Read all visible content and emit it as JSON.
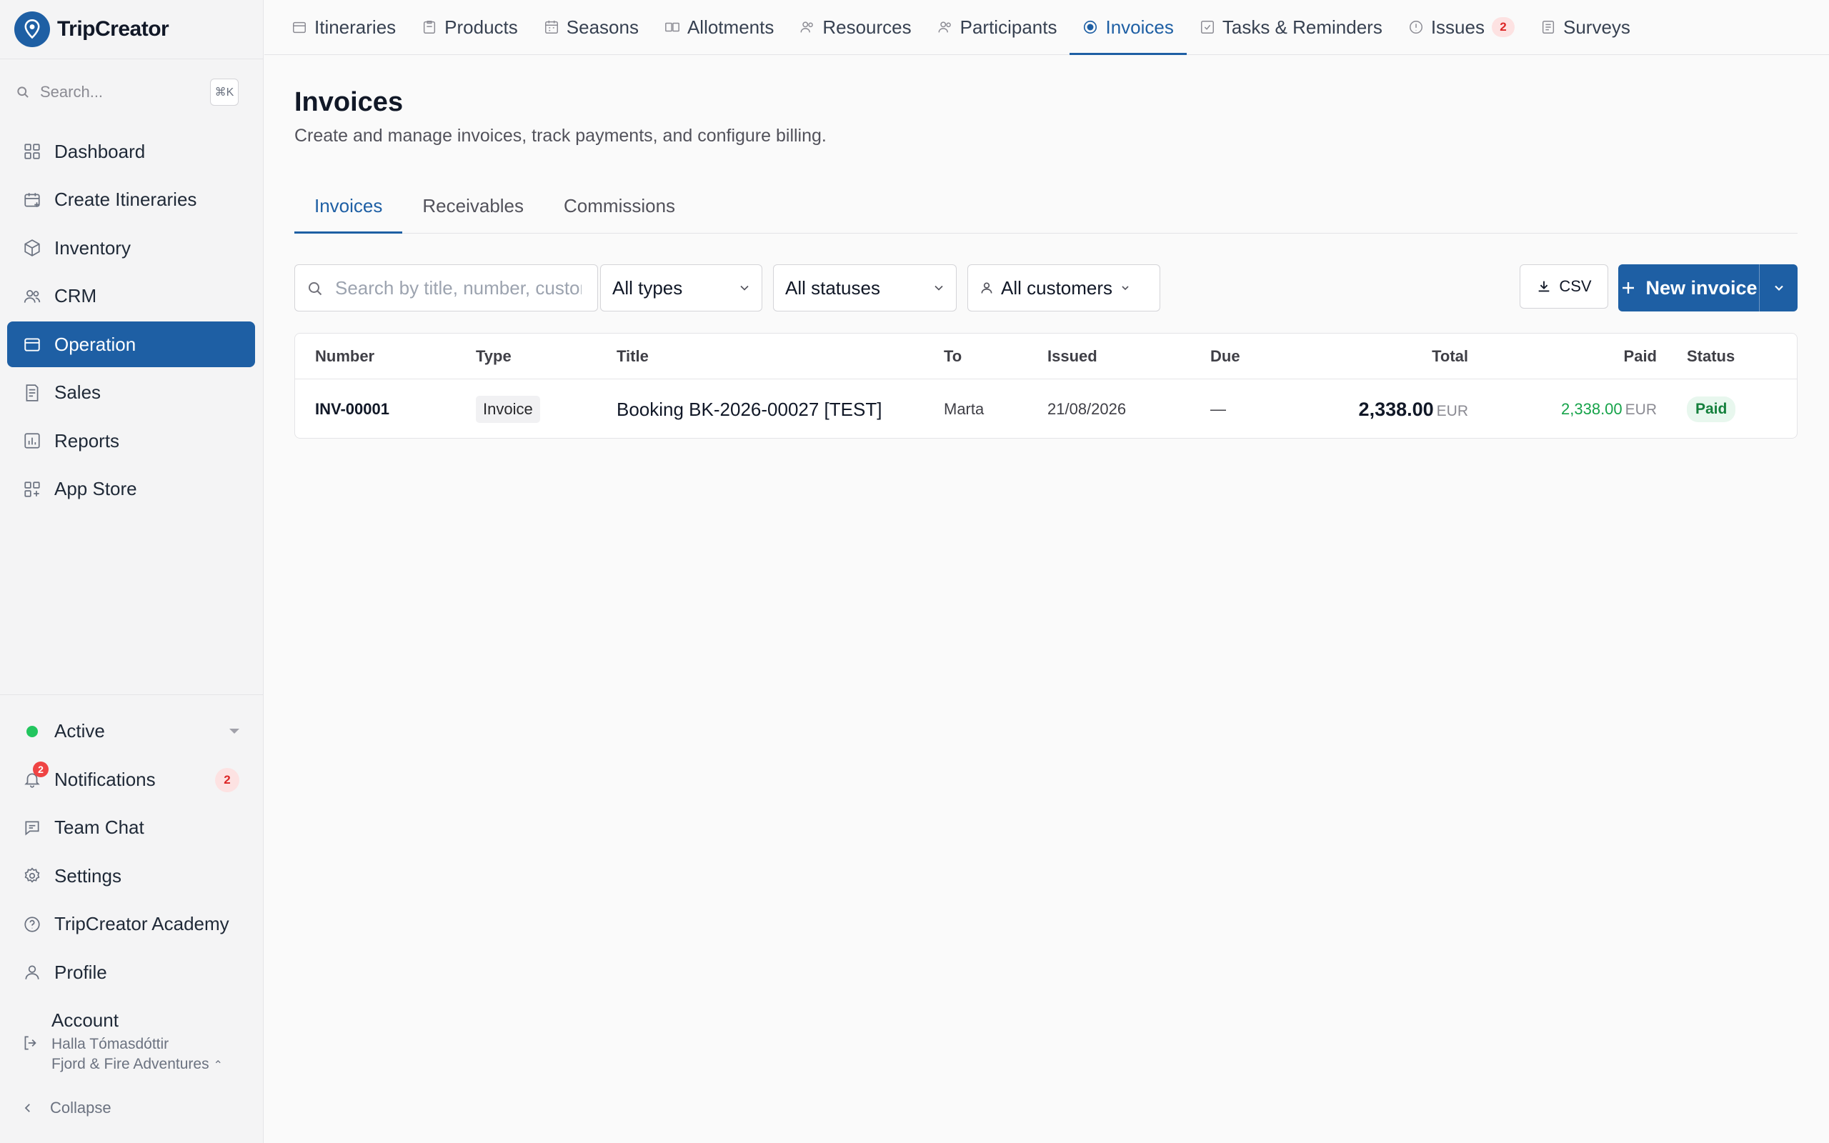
{
  "brand": {
    "name": "TripCreator",
    "color": "#1e5fa4"
  },
  "sidebar": {
    "search_placeholder": "Search...",
    "search_shortcut": "⌘K",
    "items": [
      {
        "label": "Dashboard",
        "icon": "grid-icon"
      },
      {
        "label": "Create Itineraries",
        "icon": "calendar-plus-icon"
      },
      {
        "label": "Inventory",
        "icon": "box-icon"
      },
      {
        "label": "CRM",
        "icon": "users-icon"
      },
      {
        "label": "Operation",
        "icon": "calendar-icon",
        "active": true
      },
      {
        "label": "Sales",
        "icon": "receipt-icon"
      },
      {
        "label": "Reports",
        "icon": "bar-chart-icon"
      },
      {
        "label": "App Store",
        "icon": "apps-plus-icon"
      }
    ],
    "bottom": {
      "status": "Active",
      "notifications": "Notifications",
      "notifications_count": "2",
      "team_chat": "Team Chat",
      "settings": "Settings",
      "academy": "TripCreator Academy",
      "profile": "Profile",
      "account": "Account",
      "account_user": "Halla Tómasdóttir",
      "account_company": "Fjord & Fire Adventures",
      "collapse": "Collapse"
    }
  },
  "top_tabs": [
    {
      "label": "Itineraries",
      "icon": "calendar-icon"
    },
    {
      "label": "Products",
      "icon": "clipboard-icon"
    },
    {
      "label": "Seasons",
      "icon": "calendar-grid-icon"
    },
    {
      "label": "Allotments",
      "icon": "allotment-icon"
    },
    {
      "label": "Resources",
      "icon": "people-icon"
    },
    {
      "label": "Participants",
      "icon": "people-icon"
    },
    {
      "label": "Invoices",
      "icon": "coin-icon",
      "active": true
    },
    {
      "label": "Tasks & Reminders",
      "icon": "checkbox-icon"
    },
    {
      "label": "Issues",
      "icon": "info-icon",
      "badge": "2"
    },
    {
      "label": "Surveys",
      "icon": "document-icon"
    }
  ],
  "page": {
    "title": "Invoices",
    "subtitle": "Create and manage invoices, track payments, and configure billing.",
    "subtabs": [
      "Invoices",
      "Receivables",
      "Commissions"
    ],
    "active_subtab": "Invoices"
  },
  "filters": {
    "search_placeholder": "Search by title, number, customer...",
    "search_value": "",
    "type": "All types",
    "status": "All statuses",
    "customer": "All customers"
  },
  "actions": {
    "csv": "CSV",
    "new_invoice": "New invoice"
  },
  "table": {
    "columns": [
      "Number",
      "Type",
      "Title",
      "To",
      "Issued",
      "Due",
      "Total",
      "Paid",
      "Status"
    ],
    "rows": [
      {
        "number": "INV-00001",
        "type": "Invoice",
        "title": "Booking BK-2026-00027 [TEST]",
        "to": "Marta",
        "issued": "21/08/2026",
        "due": "—",
        "total": "2,338.00",
        "total_currency": "EUR",
        "paid": "2,338.00",
        "paid_currency": "EUR",
        "status": "Paid"
      }
    ]
  },
  "colors": {
    "accent": "#1e5fa4",
    "paid": "#16a34a",
    "danger": "#dc2626",
    "status_active": "#22c55e"
  }
}
